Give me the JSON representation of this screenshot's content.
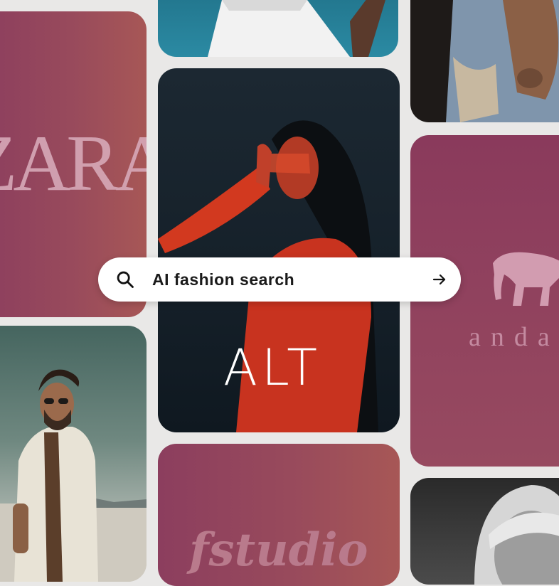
{
  "search": {
    "label": "AI fashion search",
    "lead_icon": "search-icon",
    "trail_icon": "arrow-right-icon"
  },
  "brands": {
    "zara": "ZARA",
    "alt": "ALT",
    "anda": "anda",
    "studio": "fstudio"
  },
  "colors": {
    "card_gradient_start": "#8c3e5e",
    "card_gradient_end": "#a75756",
    "background": "#e9e8e7",
    "search_bg": "#ffffff"
  }
}
